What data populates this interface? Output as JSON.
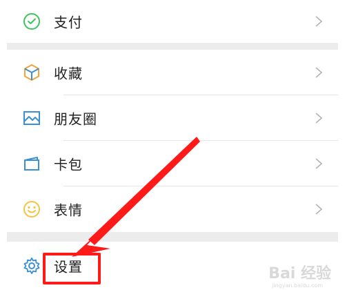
{
  "menu": {
    "items": [
      {
        "id": "pay",
        "label": "支付",
        "icon": "payment-icon"
      },
      {
        "id": "favorites",
        "label": "收藏",
        "icon": "cube-icon"
      },
      {
        "id": "moments",
        "label": "朋友圈",
        "icon": "image-icon"
      },
      {
        "id": "cards",
        "label": "卡包",
        "icon": "card-icon"
      },
      {
        "id": "stickers",
        "label": "表情",
        "icon": "smiley-icon"
      },
      {
        "id": "settings",
        "label": "设置",
        "icon": "gear-icon"
      }
    ]
  },
  "colors": {
    "pay": "#3cc45a",
    "favorites": "#f2a33a",
    "moments": "#3b8fd4",
    "cards": "#3b8fd4",
    "stickers": "#f5c33b",
    "settings": "#3b8fd4",
    "annotation": "#ff1a1a"
  },
  "watermark": {
    "text": "Bai 经验",
    "sub": "jingyan.baidu.com"
  }
}
